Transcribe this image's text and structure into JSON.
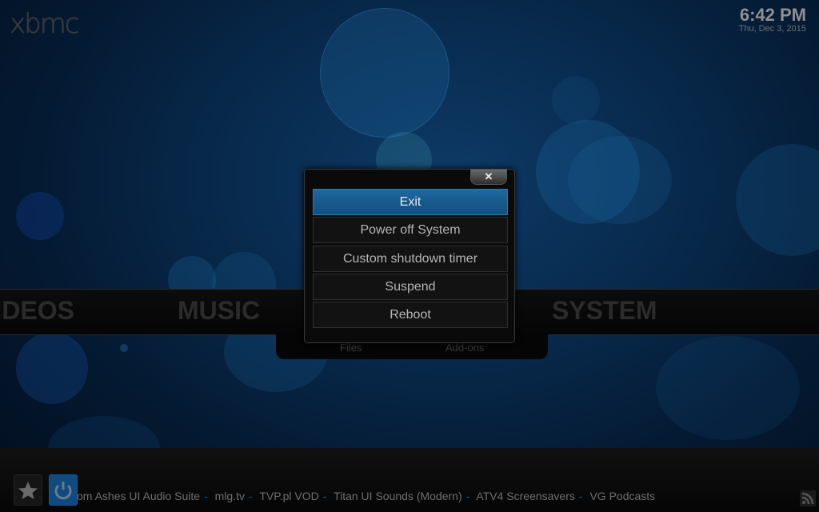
{
  "app": {
    "logo": "xbmc"
  },
  "clock": {
    "time": "6:42 PM",
    "date": "Thu, Dec 3, 2015"
  },
  "main_menu": {
    "items": [
      {
        "label": "VIDEOS"
      },
      {
        "label": "MUSIC"
      },
      {
        "label": "SYSTEM"
      }
    ],
    "submenu": [
      {
        "label": "Files"
      },
      {
        "label": "Add-ons"
      }
    ]
  },
  "dialog": {
    "close_label": "✕",
    "options": [
      {
        "label": "Exit",
        "selected": true
      },
      {
        "label": "Power off System",
        "selected": false
      },
      {
        "label": "Custom shutdown timer",
        "selected": false
      },
      {
        "label": "Suspend",
        "selected": false
      },
      {
        "label": "Reboot",
        "selected": false
      }
    ]
  },
  "footer": {
    "favourites_icon": "star-icon",
    "power_icon": "power-icon",
    "rss_icon": "rss-icon",
    "ticker": [
      "om Ashes UI Audio Suite",
      "mlg.tv",
      "TVP.pl VOD",
      "Titan UI Sounds (Modern)",
      "ATV4 Screensavers",
      "VG Podcasts"
    ],
    "separator": "-"
  },
  "colors": {
    "accent": "#1a6399",
    "background": "#062347"
  }
}
